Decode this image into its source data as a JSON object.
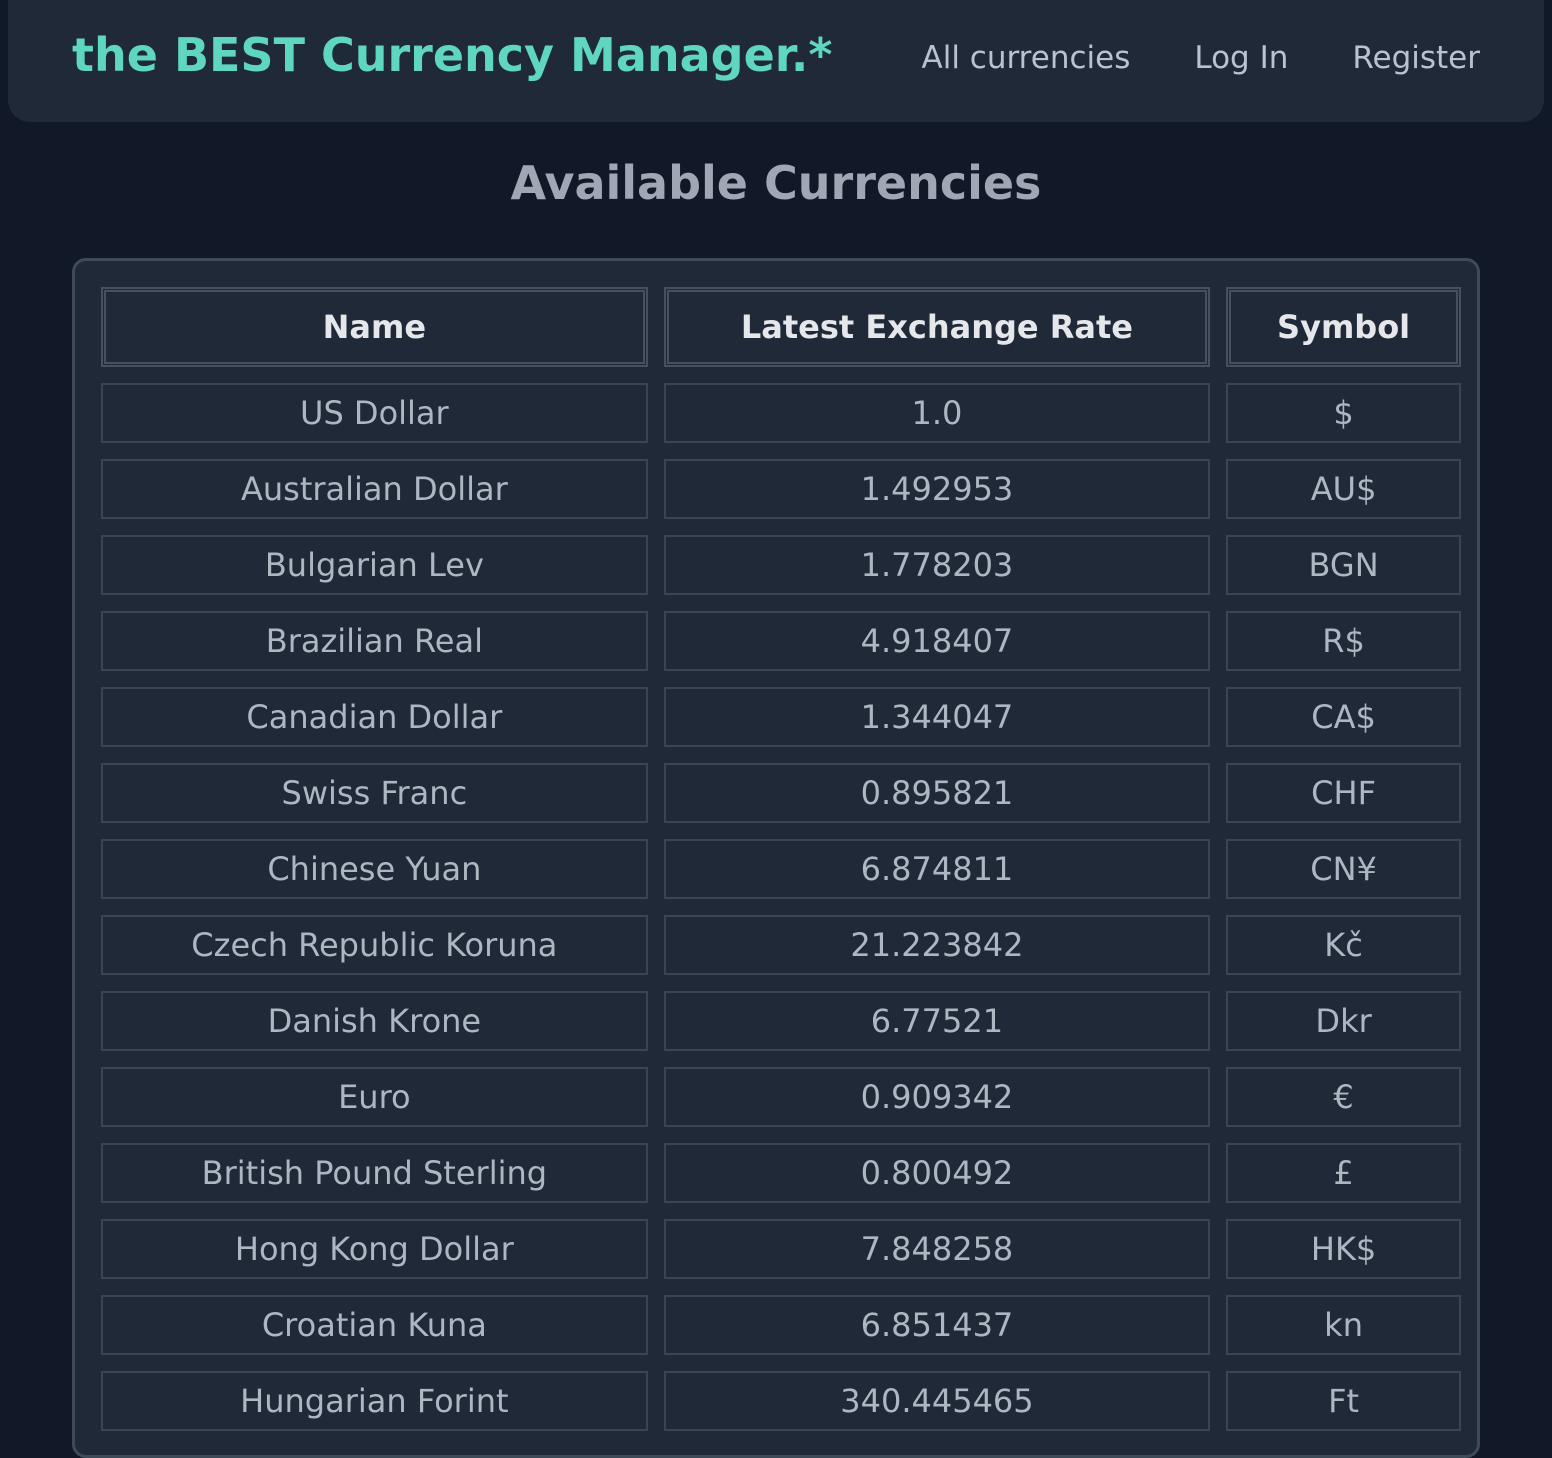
{
  "navbar": {
    "brand": "the BEST Currency Manager.*",
    "links": [
      "All currencies",
      "Log In",
      "Register"
    ]
  },
  "page": {
    "title": "Available Currencies"
  },
  "table": {
    "headers": [
      "Name",
      "Latest Exchange Rate",
      "Symbol"
    ],
    "rows": [
      [
        "US Dollar",
        "1.0",
        "$"
      ],
      [
        "Australian Dollar",
        "1.492953",
        "AU$"
      ],
      [
        "Bulgarian Lev",
        "1.778203",
        "BGN"
      ],
      [
        "Brazilian Real",
        "4.918407",
        "R$"
      ],
      [
        "Canadian Dollar",
        "1.344047",
        "CA$"
      ],
      [
        "Swiss Franc",
        "0.895821",
        "CHF"
      ],
      [
        "Chinese Yuan",
        "6.874811",
        "CN¥"
      ],
      [
        "Czech Republic Koruna",
        "21.223842",
        "Kč"
      ],
      [
        "Danish Krone",
        "6.77521",
        "Dkr"
      ],
      [
        "Euro",
        "0.909342",
        "€"
      ],
      [
        "British Pound Sterling",
        "0.800492",
        "£"
      ],
      [
        "Hong Kong Dollar",
        "7.848258",
        "HK$"
      ],
      [
        "Croatian Kuna",
        "6.851437",
        "kn"
      ],
      [
        "Hungarian Forint",
        "340.445465",
        "Ft"
      ]
    ]
  },
  "colors": {
    "background": "#111827",
    "panel": "#1f2937",
    "brand": "#5fd6c0"
  }
}
